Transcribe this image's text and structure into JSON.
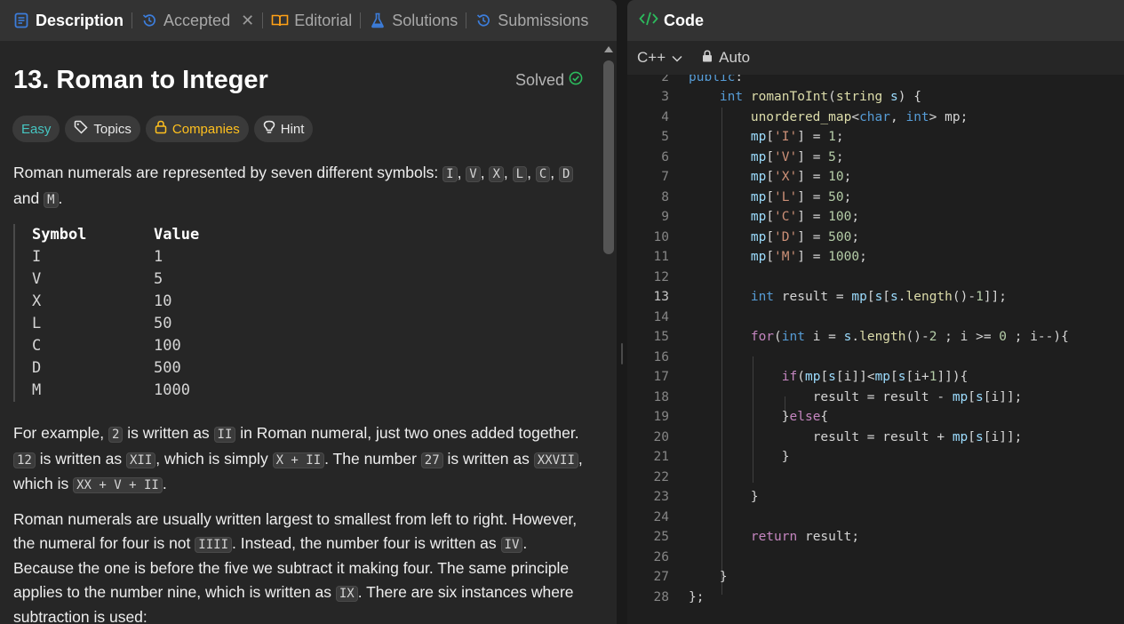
{
  "tabs": [
    {
      "label": "Description",
      "icon": "description-icon",
      "active": true
    },
    {
      "label": "Accepted",
      "icon": "history-icon",
      "active": false
    },
    {
      "label": "Editorial",
      "icon": "book-icon",
      "active": false
    },
    {
      "label": "Solutions",
      "icon": "flask-icon",
      "active": false
    },
    {
      "label": "Submissions",
      "icon": "history-icon",
      "active": false
    }
  ],
  "problem": {
    "title": "13. Roman to Integer",
    "status": "Solved",
    "chips": {
      "difficulty": "Easy",
      "topics": "Topics",
      "companies": "Companies",
      "hint": "Hint"
    }
  },
  "description": {
    "p1": {
      "text1": "Roman numerals are represented by seven different symbols: ",
      "codes": [
        "I",
        "V",
        "X",
        "L",
        "C",
        "D",
        "M"
      ],
      "sep": ", ",
      "and": "and",
      "end": "."
    },
    "table": {
      "headers": [
        "Symbol",
        "Value"
      ],
      "rows": [
        [
          "I",
          "1"
        ],
        [
          "V",
          "5"
        ],
        [
          "X",
          "10"
        ],
        [
          "L",
          "50"
        ],
        [
          "C",
          "100"
        ],
        [
          "D",
          "500"
        ],
        [
          "M",
          "1000"
        ]
      ]
    },
    "p2": {
      "t1": "For example, ",
      "c1": "2",
      "t2": " is written as ",
      "c2": "II",
      "t3": " in Roman numeral, just two ones added together.",
      "c3": "12",
      "t4": " is written as ",
      "c4": "XII",
      "t5": ", which is simply ",
      "c5": "X + II",
      "t6": ". The number ",
      "c6": "27",
      "t7": " is written as ",
      "c7": "XXVII",
      "t8": ",",
      "t9": "which is ",
      "c8": "XX + V + II",
      "t10": "."
    },
    "p3": {
      "l1": "Roman numerals are usually written largest to smallest from left to right. However,",
      "l2a": "the numeral for four is not ",
      "l2c": "IIII",
      "l2b": ". Instead, the number four is written as ",
      "l2d": "IV",
      "l2e": ".",
      "l3": "Because the one is before the five we subtract it making four. The same principle",
      "l4a": "applies to the number nine, which is written as ",
      "l4c": "IX",
      "l4b": ". There are six instances where",
      "l5": "subtraction is used:"
    }
  },
  "code_panel": {
    "title": "Code",
    "language": "C++",
    "mode": "Auto",
    "current_line": "13",
    "line_numbers": [
      "2",
      "3",
      "4",
      "5",
      "6",
      "7",
      "8",
      "9",
      "10",
      "11",
      "12",
      "13",
      "14",
      "15",
      "16",
      "17",
      "18",
      "19",
      "20",
      "21",
      "22",
      "23",
      "24",
      "25",
      "26",
      "27",
      "28"
    ]
  },
  "colors": {
    "easy": "#46c6c2",
    "companies": "#ffc01e",
    "solved_check": "#2cbb5d",
    "code_icon": "#2cbb5d"
  }
}
